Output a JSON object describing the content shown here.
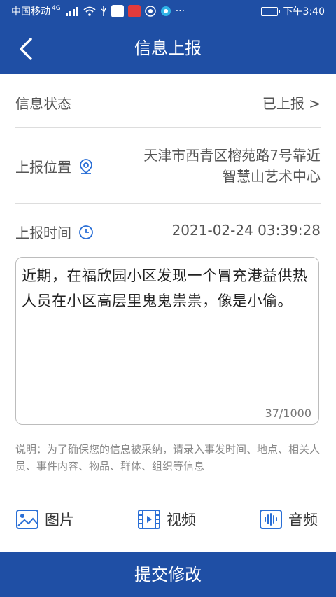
{
  "status_bar": {
    "carrier": "中国移动",
    "network": "4G",
    "time": "下午3:40",
    "more": "···"
  },
  "header": {
    "title": "信息上报",
    "back_icon": "chevron-left-icon"
  },
  "rows": {
    "status": {
      "label": "信息状态",
      "value": "已上报 >"
    },
    "location": {
      "label": "上报位置",
      "icon": "location-pin-icon",
      "value_line1": "天津市西青区榕苑路7号靠近",
      "value_line2": "智慧山艺术中心"
    },
    "time": {
      "label": "上报时间",
      "icon": "clock-icon",
      "value": "2021-02-24 03:39:28"
    }
  },
  "description": {
    "text": "近期，在福欣园小区发现一个冒充港益供热人员在小区高层里鬼鬼祟祟，像是小偷。",
    "counter": "37/1000"
  },
  "note": "说明：为了确保您的信息被采纳，请录入事发时间、地点、相关人员、事件内容、物品、群体、组织等信息",
  "media": {
    "image": "图片",
    "video": "视频",
    "audio": "音频"
  },
  "submit_label": "提交修改",
  "colors": {
    "brand": "#1f4fa5",
    "icon": "#2a6fd6"
  }
}
